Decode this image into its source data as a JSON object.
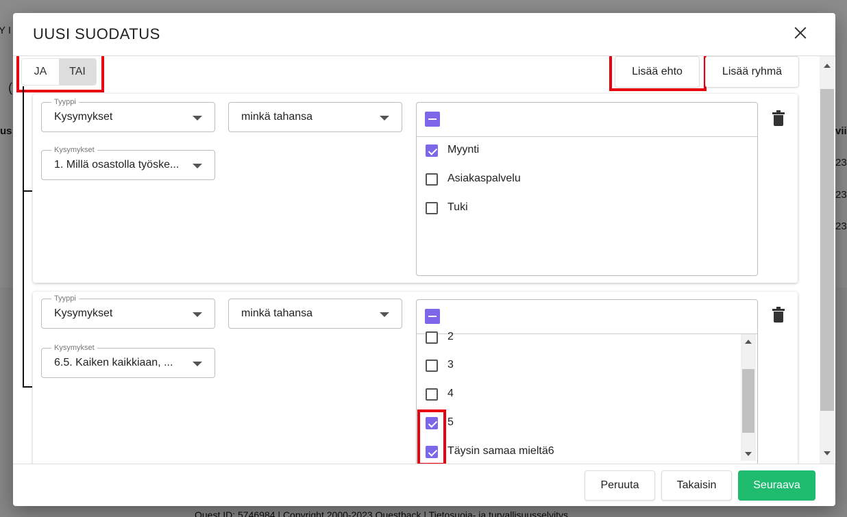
{
  "background": {
    "left_fragments": [
      "Y I",
      "(",
      "us"
    ],
    "right_fragments": [
      "vii",
      "23",
      "23",
      "23"
    ],
    "footer": "Quest ID: 5746984 | Copyright 2000-2023 Questback | Tietosuoja- ja turvallisuusselvitys"
  },
  "dialog": {
    "title": "UUSI SUODATUS",
    "close_icon": "close-icon",
    "logic_toggle": {
      "and_label": "JA",
      "or_label": "TAI",
      "selected": "TAI"
    },
    "add_condition_label": "Lisää ehto",
    "add_group_label": "Lisää ryhmä",
    "conditions": [
      {
        "type_label": "Tyyppi",
        "type_value": "Kysymykset",
        "operator_value": "minkä tahansa",
        "question_label": "Kysymykset",
        "question_value": "1. Millä osastolla työske...",
        "options": [
          {
            "label": "Myynti",
            "checked": true
          },
          {
            "label": "Asiakaspalvelu",
            "checked": false
          },
          {
            "label": "Tuki",
            "checked": false
          }
        ]
      },
      {
        "type_label": "Tyyppi",
        "type_value": "Kysymykset",
        "operator_value": "minkä tahansa",
        "question_label": "Kysymykset",
        "question_value": "6.5. Kaiken kaikkiaan, ...",
        "options": [
          {
            "label": "2",
            "checked": false
          },
          {
            "label": "3",
            "checked": false
          },
          {
            "label": "4",
            "checked": false
          },
          {
            "label": "5",
            "checked": true
          },
          {
            "label": "Täysin samaa mieltä6",
            "checked": true
          }
        ]
      }
    ],
    "footer_buttons": {
      "cancel": "Peruuta",
      "back": "Takaisin",
      "next": "Seuraava"
    }
  },
  "colors": {
    "accent": "#7d67e8",
    "primary_button": "#1fbb6f",
    "highlight": "#e8000f"
  }
}
